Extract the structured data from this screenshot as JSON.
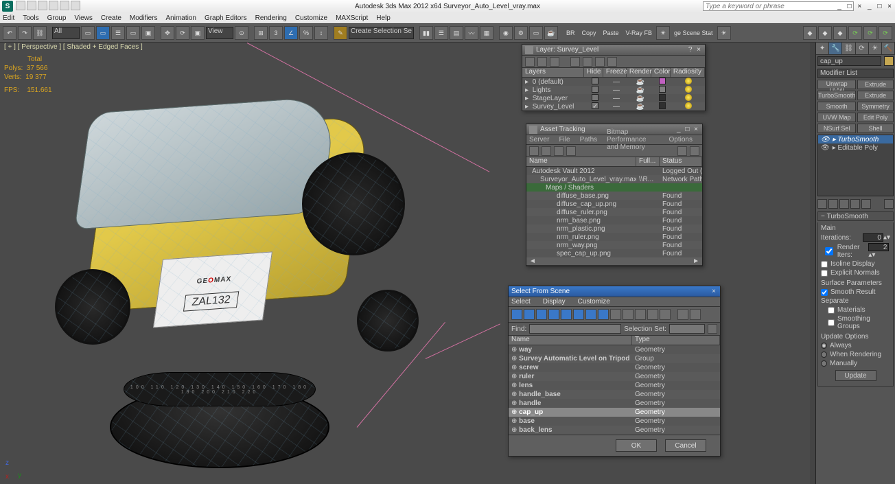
{
  "app": {
    "logo": "S",
    "title": "Autodesk 3ds Max  2012 x64     Surveyor_Auto_Level_vray.max",
    "search_placeholder": "Type a keyword or phrase",
    "winctl": "_ □ ×  _ □ ×"
  },
  "menu": [
    "Edit",
    "Tools",
    "Group",
    "Views",
    "Create",
    "Modifiers",
    "Animation",
    "Graph Editors",
    "Rendering",
    "Customize",
    "MAXScript",
    "Help"
  ],
  "toolbar": {
    "all": "All",
    "create_sel": "Create Selection Se",
    "br": "BR",
    "copy": "Copy",
    "paste": "Paste",
    "vrayfb": "V-Ray FB",
    "scenestat": "ge Scene Stat"
  },
  "viewport": {
    "label": "[ + ] [ Perspective ] [ Shaded + Edged Faces ]",
    "stats_hdr": "Total",
    "polys_l": "Polys:",
    "polys_v": "37 566",
    "verts_l": "Verts:",
    "verts_v": "19 377",
    "fps_l": "FPS:",
    "fps_v": "151.661"
  },
  "model": {
    "brand_pre": "GE",
    "brand_mid": "O",
    "brand_post": "MAX",
    "model": "ZAL132",
    "dial": "100 110 120 130 140 150 160 170 180 190 200 210 220"
  },
  "layer": {
    "title": "Layer: Survey_Level",
    "cols": [
      "Layers",
      "Hide",
      "Freeze",
      "Render",
      "Color",
      "Radiosity"
    ],
    "rows": [
      {
        "name": "0 (default)",
        "color": "#c060c0"
      },
      {
        "name": "Lights",
        "color": "#808080"
      },
      {
        "name": "StageLayer",
        "color": "#303030"
      },
      {
        "name": "Survey_Level",
        "color": "#303030",
        "checked": true
      }
    ]
  },
  "asset": {
    "title": "Asset Tracking",
    "menu": [
      "Server",
      "File",
      "Paths",
      "Bitmap Performance and Memory",
      "Options"
    ],
    "cols": [
      "Name",
      "Full...",
      "Status"
    ],
    "rows": [
      {
        "name": "Autodesk Vault 2012",
        "path": "",
        "status": "Logged Out (..."
      },
      {
        "name": "Surveyor_Auto_Level_vray.max",
        "path": "\\\\R...",
        "status": "Network Path ..."
      },
      {
        "name": "Maps / Shaders",
        "path": "",
        "status": "",
        "group": true
      },
      {
        "name": "diffuse_base.png",
        "path": "",
        "status": "Found"
      },
      {
        "name": "diffuse_cap_up.png",
        "path": "",
        "status": "Found"
      },
      {
        "name": "diffuse_ruler.png",
        "path": "",
        "status": "Found"
      },
      {
        "name": "nrm_base.png",
        "path": "",
        "status": "Found"
      },
      {
        "name": "nrm_plastic.png",
        "path": "",
        "status": "Found"
      },
      {
        "name": "nrm_ruler.png",
        "path": "",
        "status": "Found"
      },
      {
        "name": "nrm_way.png",
        "path": "",
        "status": "Found"
      },
      {
        "name": "spec_cap_up.png",
        "path": "",
        "status": "Found"
      }
    ]
  },
  "select": {
    "title": "Select From Scene",
    "menu": [
      "Select",
      "Display",
      "Customize"
    ],
    "find_l": "Find:",
    "selset_l": "Selection Set:",
    "cols": [
      "Name",
      "Type"
    ],
    "rows": [
      {
        "name": "way",
        "type": "Geometry"
      },
      {
        "name": "Survey Automatic Level on Tripod",
        "type": "Group"
      },
      {
        "name": "screw",
        "type": "Geometry"
      },
      {
        "name": "ruler",
        "type": "Geometry"
      },
      {
        "name": "lens",
        "type": "Geometry"
      },
      {
        "name": "handle_base",
        "type": "Geometry"
      },
      {
        "name": "handle",
        "type": "Geometry"
      },
      {
        "name": "cap_up",
        "type": "Geometry",
        "sel": true
      },
      {
        "name": "base",
        "type": "Geometry"
      },
      {
        "name": "back_lens",
        "type": "Geometry"
      }
    ],
    "ok": "OK",
    "cancel": "Cancel"
  },
  "cmd": {
    "obj": "cap_up",
    "modlist": "Modifier List",
    "mods": [
      "Unwrap UVW",
      "Extrude",
      "TurboSmooth",
      "Extrude",
      "Smooth",
      "Symmetry",
      "UVW Map",
      "Edit Poly",
      "NSurf Sel",
      "Shell"
    ],
    "stack": [
      "TurboSmooth",
      "Editable Poly"
    ],
    "rollup": "TurboSmooth",
    "main": "Main",
    "iter_l": "Iterations:",
    "iter_v": "0",
    "render_iter_l": "Render Iters:",
    "render_iter_v": "2",
    "isoline": "Isoline Display",
    "explicit": "Explicit Normals",
    "surf": "Surface Parameters",
    "smoothres": "Smooth Result",
    "separate": "Separate",
    "mats": "Materials",
    "smgroups": "Smoothing Groups",
    "updopt": "Update Options",
    "always": "Always",
    "whenrender": "When Rendering",
    "manually": "Manually",
    "update": "Update"
  }
}
